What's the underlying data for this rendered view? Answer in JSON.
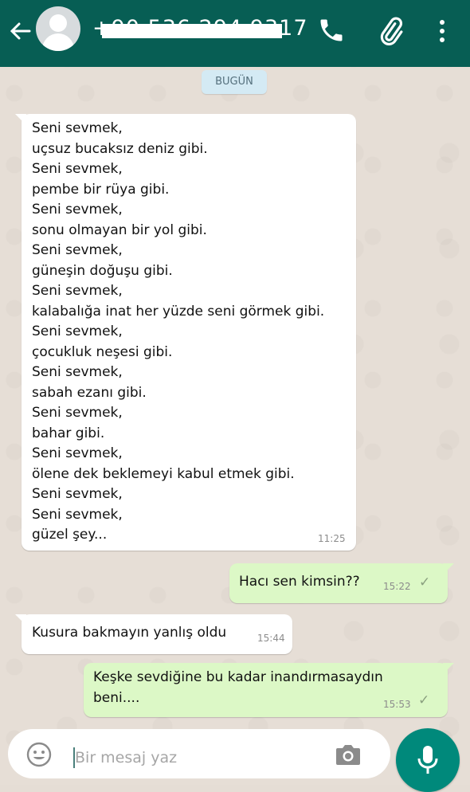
{
  "header": {
    "contact_phone": "+90 536 294 9317",
    "back_icon": "arrow-left-icon",
    "call_icon": "phone-icon",
    "attach_icon": "paperclip-icon",
    "menu_icon": "more-vert-icon"
  },
  "date_chip": "BUGÜN",
  "messages": [
    {
      "direction": "incoming",
      "text": "Seni sevmek,\nuçsuz bucaksız deniz gibi.\nSeni sevmek,\npembe bir rüya gibi.\nSeni sevmek,\nsonu olmayan bir yol gibi.\nSeni sevmek,\ngüneşin doğuşu gibi.\nSeni sevmek,\nkalabalığa inat her yüzde seni görmek gibi.\nSeni sevmek,\nçocukluk neşesi gibi.\nSeni sevmek,\nsabah ezanı gibi.\nSeni sevmek,\nbahar gibi.\nSeni sevmek,\nölene dek beklemeyi kabul etmek gibi.\nSeni sevmek,\nSeni sevmek,\ngüzel şey...",
      "time": "11:25"
    },
    {
      "direction": "outgoing",
      "text": "Hacı sen kimsin??",
      "time": "15:22",
      "status": "✓"
    },
    {
      "direction": "incoming",
      "text": "Kusura bakmayın yanlış oldu",
      "time": "15:44"
    },
    {
      "direction": "outgoing",
      "text": "Keşke sevdiğine bu kadar inandırmasaydın\nbeni....",
      "time": "15:53",
      "status": "✓"
    }
  ],
  "composer": {
    "placeholder": "Bir mesaj yaz",
    "emoji_icon": "emoji-icon",
    "camera_icon": "camera-icon",
    "mic_icon": "microphone-icon"
  },
  "colors": {
    "header": "#075e54",
    "outgoing_bubble": "#dcf8c6",
    "incoming_bubble": "#ffffff",
    "mic_button": "#00897b"
  }
}
